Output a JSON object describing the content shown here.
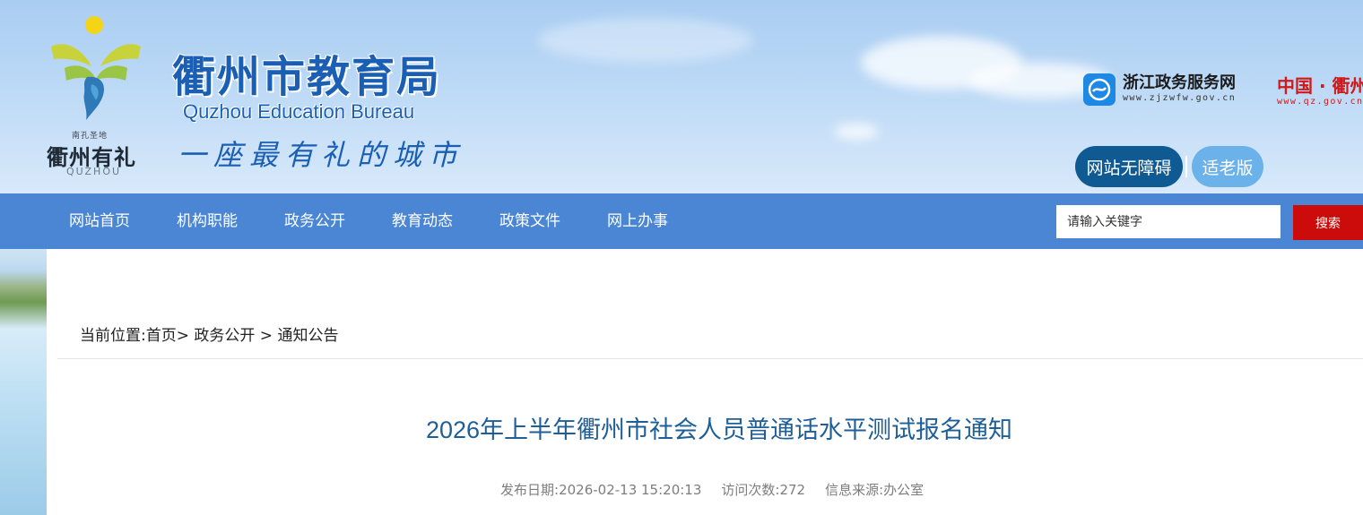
{
  "header": {
    "site_title_cn": "衢州市教育局",
    "site_title_en": "Quzhou Education Bureau",
    "slogan": "一座最有礼的城市",
    "logo": {
      "motto_small": "南孔圣地",
      "city_name": "衢州有礼",
      "pinyin": "QUZHOU"
    },
    "zjzw": {
      "name": "浙江政务服务网",
      "url": "www.zjzwfw.gov.cn",
      "icon": "zjzw-logo-icon"
    },
    "zgqz": {
      "name": "中国 · 衢州",
      "url": "www.qz.gov.cn"
    },
    "accessibility_label": "网站无障碍",
    "elder_label": "适老版"
  },
  "nav": {
    "items": [
      {
        "label": "网站首页"
      },
      {
        "label": "机构职能"
      },
      {
        "label": "政务公开"
      },
      {
        "label": "教育动态"
      },
      {
        "label": "政策文件"
      },
      {
        "label": "网上办事"
      }
    ],
    "search": {
      "placeholder": "请输入关键字",
      "button_label": "搜索"
    }
  },
  "breadcrumb": {
    "prefix": "当前位置:",
    "items": [
      "首页",
      "政务公开",
      "通知公告"
    ]
  },
  "article": {
    "title": "2026年上半年衢州市社会人员普通话水平测试报名通知",
    "publish_label": "发布日期:",
    "publish_date": "2026-02-13 15:20:13",
    "visits_label": "访问次数:",
    "visits": "272",
    "source_label": "信息来源:",
    "source": "办公室"
  },
  "colors": {
    "nav_bg": "#4a86d4",
    "title_blue": "#1a5fb4",
    "search_red": "#cc0b0b",
    "accessibility_btn": "#0f5a92",
    "elder_btn": "#6bb1ea"
  }
}
